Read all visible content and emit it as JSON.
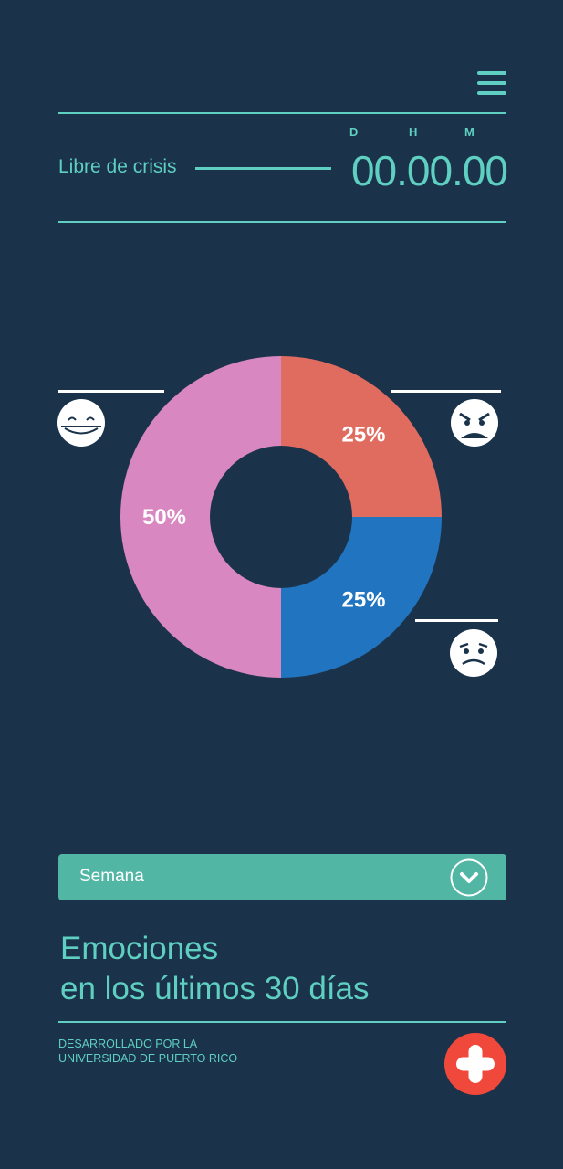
{
  "header": {
    "menu_icon": "hamburger-menu-icon",
    "units": {
      "d": "D",
      "h": "H",
      "m": "M"
    },
    "crisis_label": "Libre de crisis",
    "timer": "00.00.00"
  },
  "chart_data": {
    "type": "pie",
    "donut": true,
    "slices": [
      {
        "label": "25%",
        "value": 25,
        "color": "#e06b5f",
        "face": "angry-face-icon"
      },
      {
        "label": "25%",
        "value": 25,
        "color": "#2174bf",
        "face": "worried-face-icon"
      },
      {
        "label": "50%",
        "value": 50,
        "color": "#d987c0",
        "face": "happy-face-icon"
      }
    ]
  },
  "filter": {
    "selected": "Semana",
    "icon": "chevron-down-icon"
  },
  "section_title": {
    "line1": "Emociones",
    "line2": "en los últimos 30 días"
  },
  "footer": {
    "credit_line1": "DESARROLLADO POR LA",
    "credit_line2": "UNIVERSIDAD DE PUERTO RICO",
    "emergency_icon": "plus-icon",
    "emergency_color": "#f0483a"
  },
  "colors": {
    "background": "#1b334a",
    "accent": "#5ecfc1",
    "dropdown": "#52b6a5"
  }
}
